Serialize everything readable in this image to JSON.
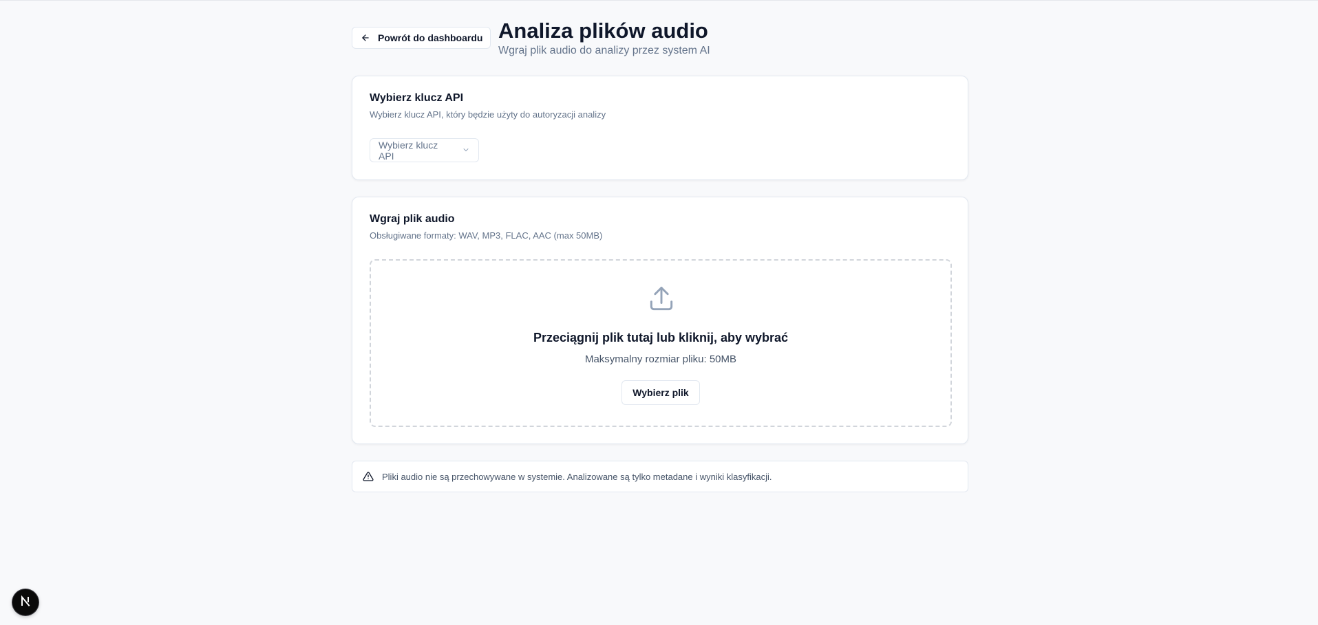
{
  "header": {
    "back_label": "Powrót do dashboardu",
    "title": "Analiza plików audio",
    "subtitle": "Wgraj plik audio do analizy przez system AI"
  },
  "api_card": {
    "title": "Wybierz klucz API",
    "description": "Wybierz klucz API, który będzie użyty do autoryzacji analizy",
    "select_placeholder": "Wybierz klucz API"
  },
  "upload_card": {
    "title": "Wgraj plik audio",
    "description": "Obsługiwane formaty: WAV, MP3, FLAC, AAC (max 50MB)",
    "dropzone_title": "Przeciągnij plik tutaj lub kliknij, aby wybrać",
    "dropzone_subtitle": "Maksymalny rozmiar pliku: 50MB",
    "choose_button": "Wybierz plik"
  },
  "notice": {
    "text": "Pliki audio nie są przechowywane w systemie. Analizowane są tylko metadane i wyniki klasyfikacji."
  },
  "icons": {
    "back": "arrow-left-icon",
    "select": "chevron-down-icon",
    "upload": "upload-icon",
    "alert": "alert-triangle-icon",
    "dev_badge": "nextjs-logo-icon"
  },
  "colors": {
    "background": "#f8f9fb",
    "card": "#ffffff",
    "border": "#e2e8f0",
    "text_primary": "#0f172a",
    "text_muted": "#64748b",
    "dropzone_border": "#d1d5db",
    "icon_muted": "#94a3b8"
  }
}
